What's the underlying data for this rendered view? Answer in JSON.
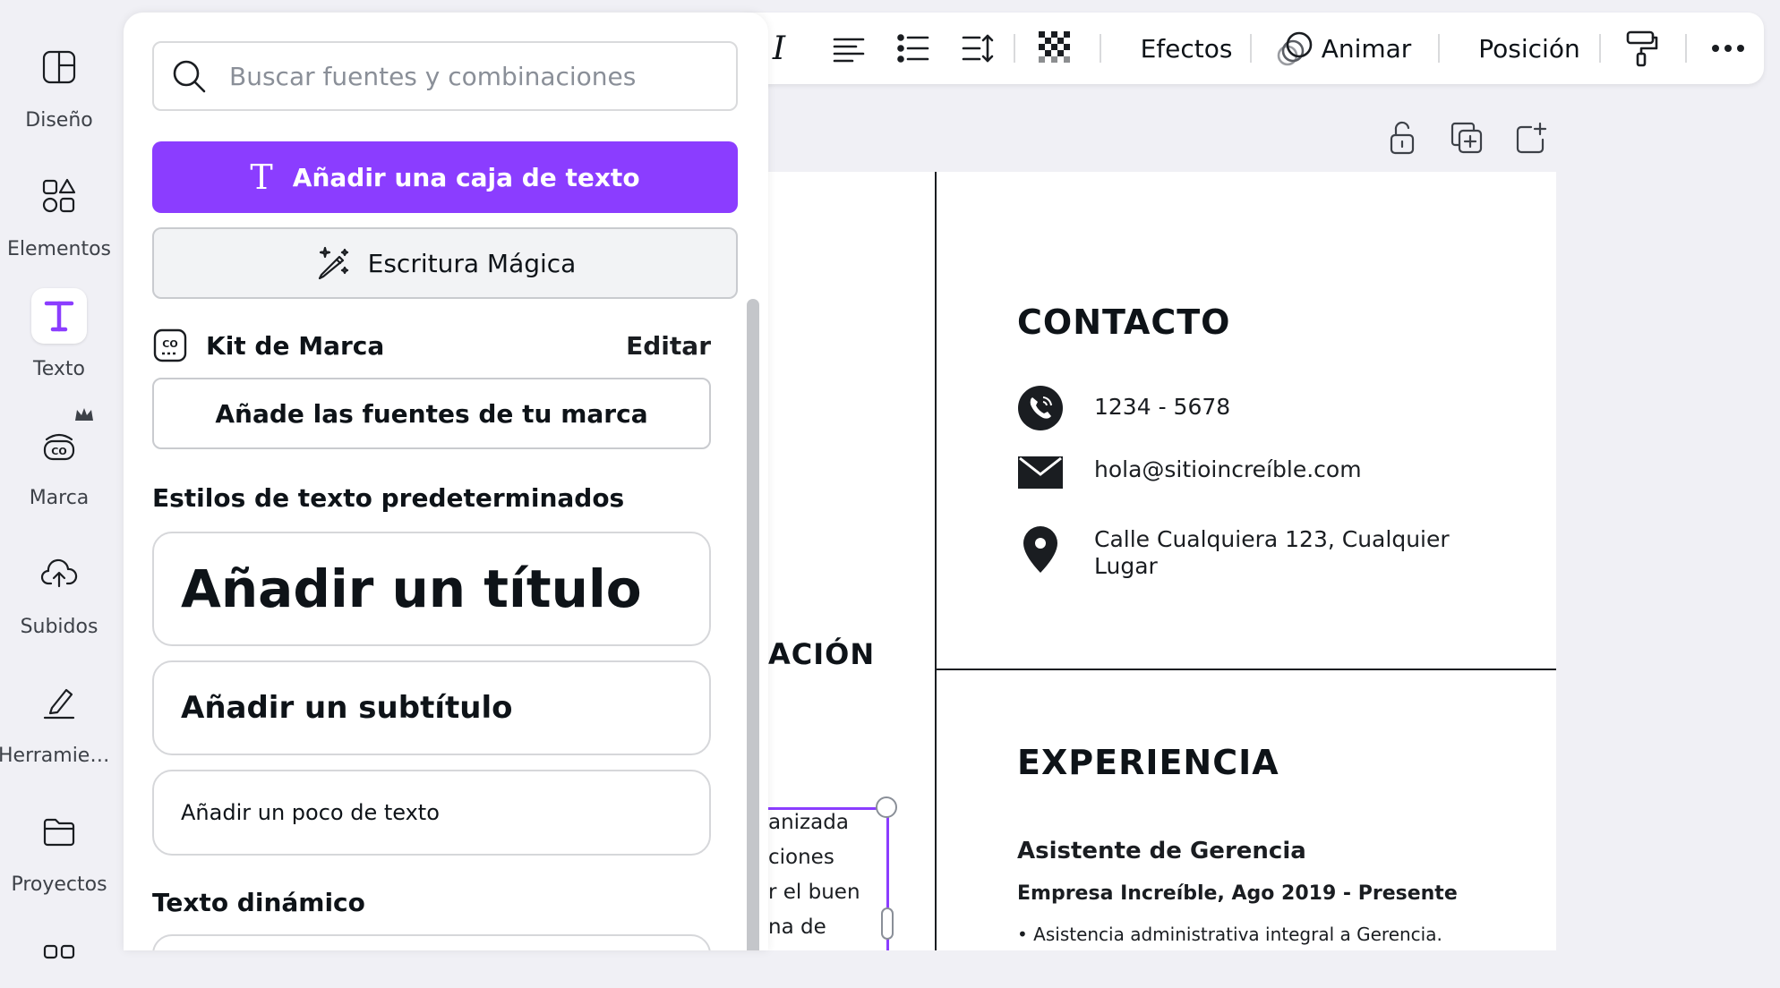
{
  "rail": {
    "items": [
      {
        "label": "Diseño",
        "icon": "layout-icon"
      },
      {
        "label": "Elementos",
        "icon": "shapes-icon"
      },
      {
        "label": "Texto",
        "icon": "text-icon",
        "active": true
      },
      {
        "label": "Marca",
        "icon": "brand-icon"
      },
      {
        "label": "Subidos",
        "icon": "upload-cloud-icon"
      },
      {
        "label": "Herramientas",
        "icon": "pen-tool-icon"
      },
      {
        "label": "Proyectos",
        "icon": "folder-icon"
      }
    ]
  },
  "panel": {
    "search_placeholder": "Buscar fuentes y combinaciones",
    "add_textbox": "Añadir una caja de texto",
    "magic_write": "Escritura Mágica",
    "brand_kit": {
      "title": "Kit de Marca",
      "edit": "Editar",
      "add_fonts": "Añade las fuentes de tu marca"
    },
    "default_styles_heading": "Estilos de texto predeterminados",
    "add_title": "Añadir un título",
    "add_subtitle": "Añadir un subtítulo",
    "add_body": "Añadir un poco de texto",
    "dynamic_heading": "Texto dinámico"
  },
  "toolbar": {
    "italic": "I",
    "effects": "Efectos",
    "animate": "Animar",
    "position": "Posición"
  },
  "page": {
    "contact_heading": "CONTACTO",
    "phone": "1234 - 5678",
    "email": "hola@sitioincreíble.com",
    "address_line1": "Calle Cualquiera 123, Cualquier",
    "address_line2": "Lugar",
    "formacion_partial": "ACIÓN",
    "experience_heading": "EXPERIENCIA",
    "job_title": "Asistente de Gerencia",
    "job_company": "Empresa Increíble, Ago 2019 - Presente",
    "job_bullet": "• Asistencia administrativa integral a Gerencia.",
    "left_lines": [
      "anizada",
      "ciones",
      "r el buen",
      "na de"
    ]
  },
  "colors": {
    "accent": "#8b3dff",
    "background": "#f0f0f5"
  }
}
